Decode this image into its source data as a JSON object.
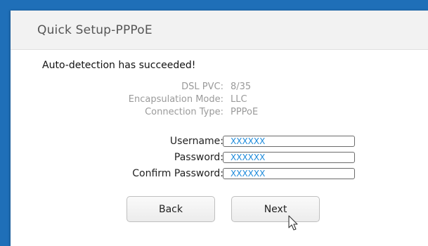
{
  "dialog": {
    "title": "Quick Setup-PPPoE",
    "status": "Auto-detection has succeeded!"
  },
  "info": [
    {
      "label": "DSL PVC:",
      "value": "8/35"
    },
    {
      "label": "Encapsulation Mode:",
      "value": "LLC"
    },
    {
      "label": "Connection Type:",
      "value": "PPPoE"
    }
  ],
  "form": {
    "username_label": "Username:",
    "username_value": "XXXXXX",
    "password_label": "Password:",
    "password_value": "XXXXXX",
    "confirm_label": "Confirm Password:",
    "confirm_value": "XXXXXX"
  },
  "buttons": {
    "back_label": "Back",
    "next_label": "Next"
  },
  "colors": {
    "background_blue": "#1f6fb8",
    "input_text": "#1c8adb",
    "info_text": "#9a9a9a"
  },
  "icons": {
    "cursor": "mouse-pointer-icon"
  }
}
